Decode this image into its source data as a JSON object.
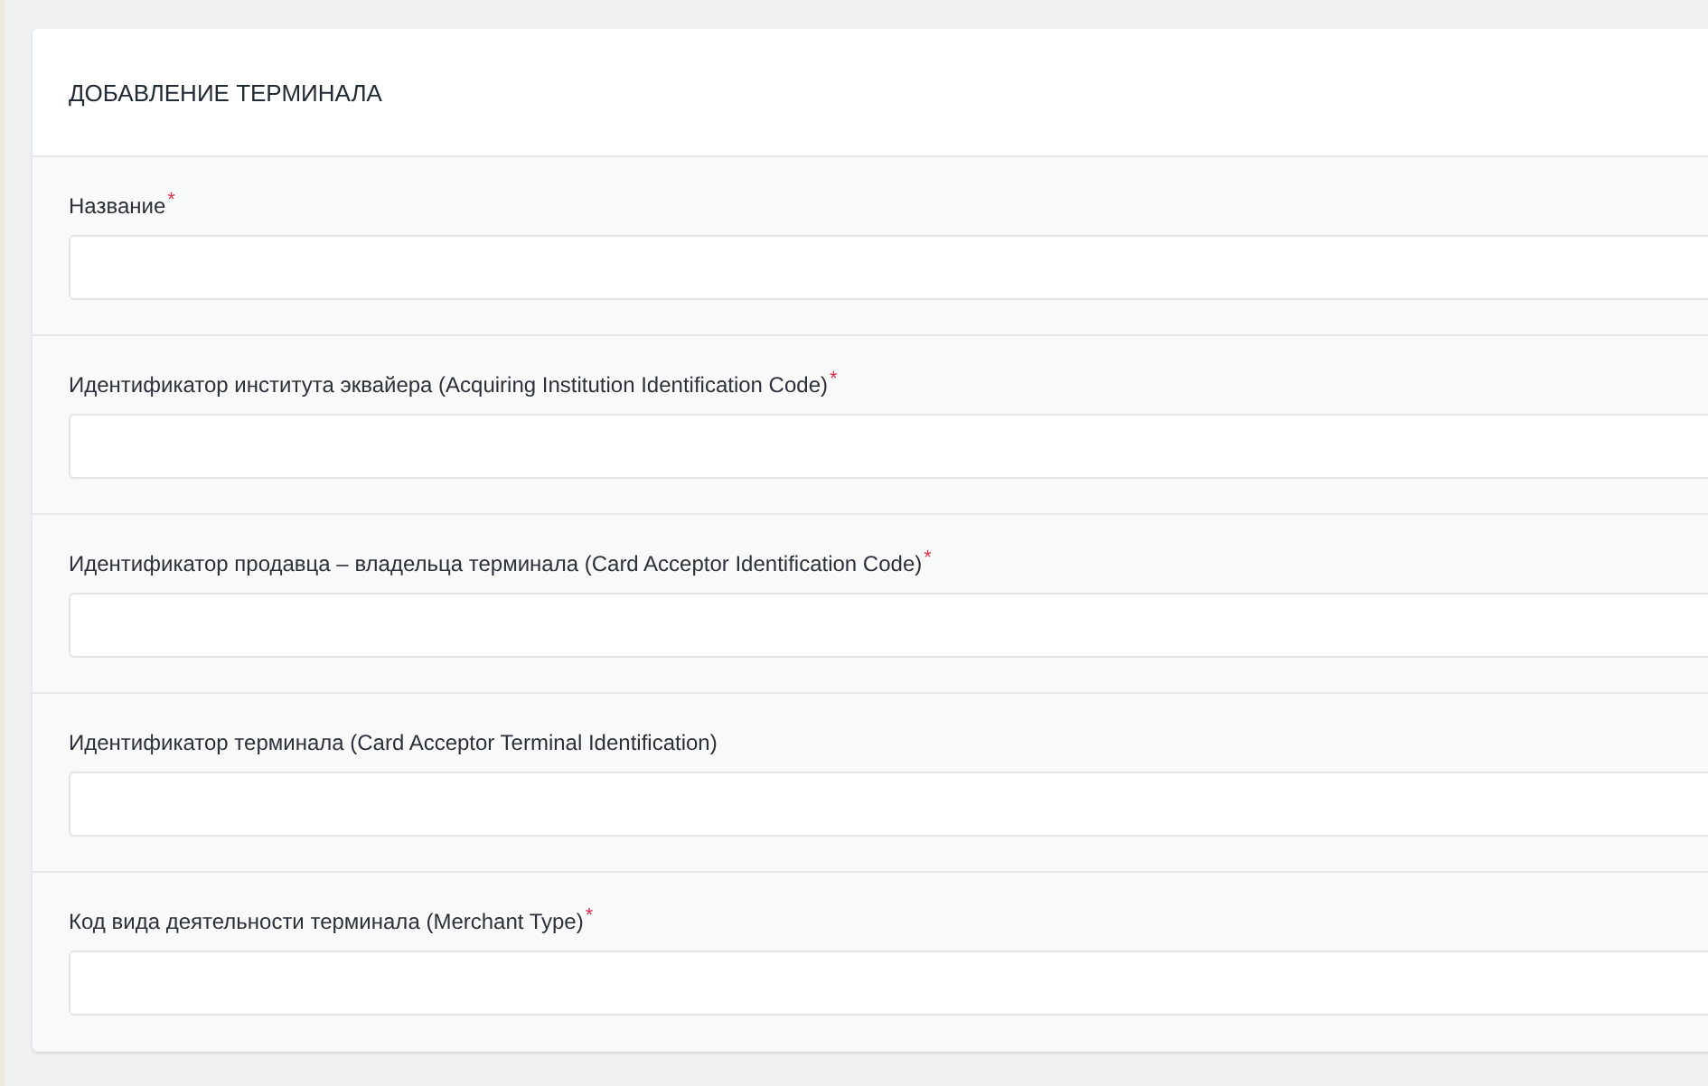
{
  "card": {
    "title": "ДОБАВЛЕНИЕ ТЕРМИНАЛА"
  },
  "fields": [
    {
      "label": "Название",
      "required_mark": "*"
    },
    {
      "label": "Идентификатор института эквайера (Acquiring Institution Identification Code)",
      "required_mark": "*"
    },
    {
      "label": "Идентификатор продавца – владельца терминала (Card Acceptor Identification Code)",
      "required_mark": "*"
    },
    {
      "label": "Идентификатор терминала (Card Acceptor Terminal Identification)"
    },
    {
      "label": "Код вида деятельности терминала (Merchant Type)",
      "required_mark": "*"
    }
  ]
}
